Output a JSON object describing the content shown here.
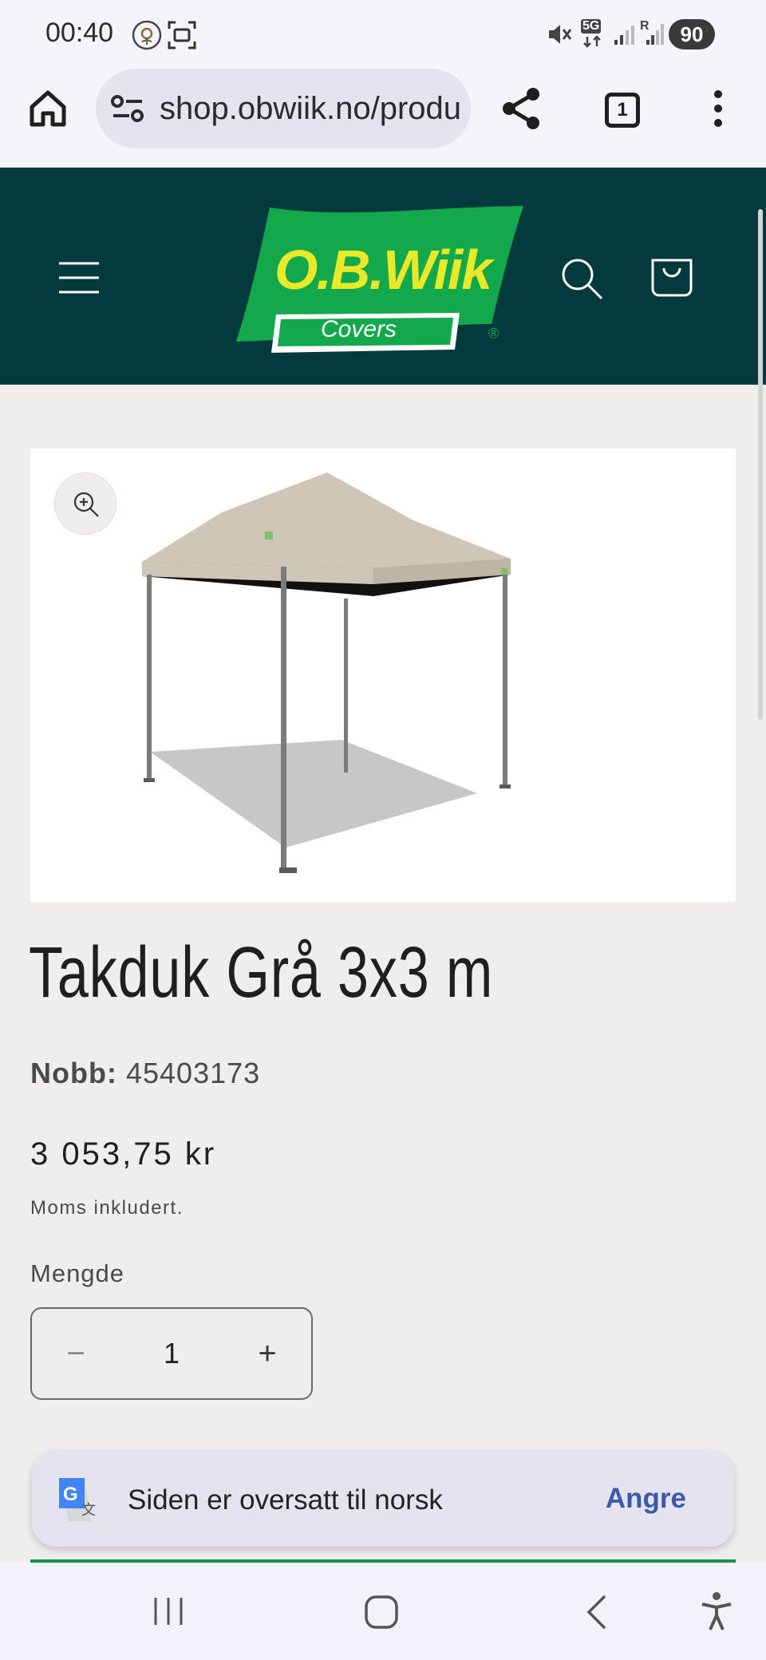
{
  "status_bar": {
    "time": "00:40",
    "battery": "90",
    "network": "5G",
    "roaming": "R"
  },
  "browser": {
    "url": "shop.obwiik.no/produ",
    "tab_count": "1"
  },
  "site": {
    "logo_title": "O.B.Wiik",
    "logo_subtitle": "Covers",
    "logo_mark": "®",
    "header_bg": "#033a3d",
    "logo_green": "#13a84b",
    "logo_yellow": "#e9e92a"
  },
  "product": {
    "title": "Takduk Grå 3x3 m",
    "sku_label": "Nobb:",
    "sku_value": "45403173",
    "price": "3 053,75 kr",
    "tax_note": "Moms inkludert.",
    "quantity_label": "Mengde",
    "quantity": "1",
    "decrease_symbol": "−",
    "increase_symbol": "+"
  },
  "translate": {
    "message": "Siden er oversatt til norsk",
    "undo_label": "Angre"
  }
}
